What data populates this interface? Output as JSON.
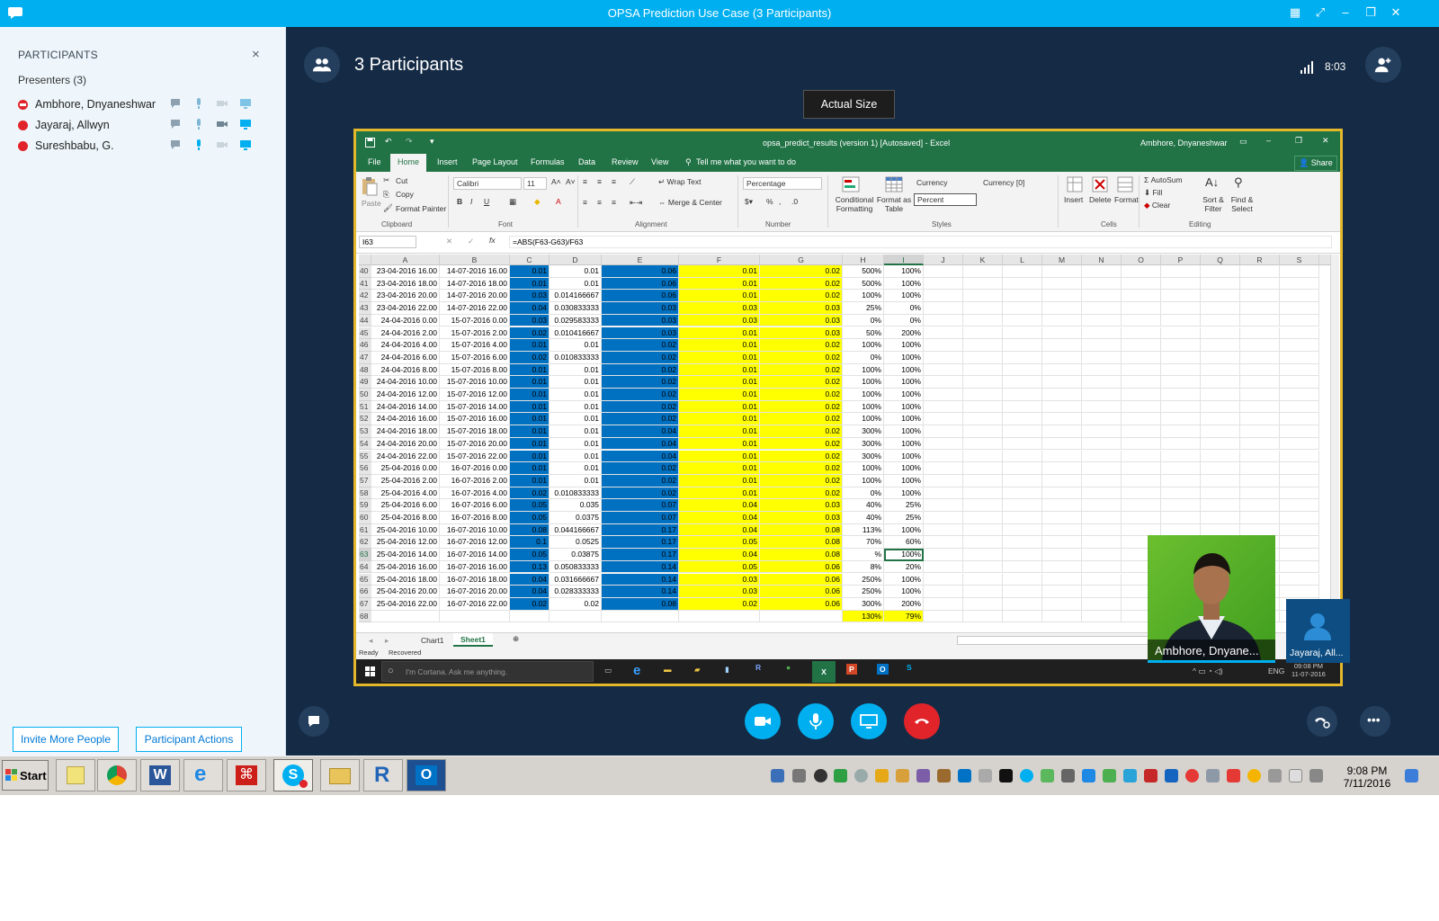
{
  "window": {
    "title": "OPSA Prediction Use Case (3 Participants)"
  },
  "panel": {
    "heading": "PARTICIPANTS",
    "close": "×",
    "section": "Presenters (3)",
    "participants": [
      {
        "name": "Ambhore, Dnyaneshwar"
      },
      {
        "name": "Jayaraj, Allwyn"
      },
      {
        "name": "Sureshbabu, G."
      }
    ],
    "invite_label": "Invite More People",
    "actions_label": "Participant Actions"
  },
  "stage": {
    "title": "3 Participants",
    "time": "8:03",
    "actual_size_label": "Actual Size"
  },
  "excel": {
    "title": "opsa_predict_results (version 1) [Autosaved] - Excel",
    "user": "Ambhore, Dnyaneshwar",
    "share": "Share",
    "tabs": [
      "File",
      "Home",
      "Insert",
      "Page Layout",
      "Formulas",
      "Data",
      "Review",
      "View",
      "Tell me what you want to do"
    ],
    "ribbon": {
      "paste": "Paste",
      "cut": "Cut",
      "copy": "Copy",
      "format_painter": "Format Painter",
      "font": "Calibri",
      "font_size": "11",
      "wrap": "Wrap Text",
      "merge": "Merge & Center",
      "number_format": "Percentage",
      "conditional": "Conditional Formatting",
      "format_table": "Format as Table",
      "style1": "Currency",
      "style2": "Currency [0]",
      "style3": "Percent",
      "insert": "Insert",
      "delete": "Delete",
      "format": "Format",
      "autosum": "AutoSum",
      "fill": "Fill",
      "clear": "Clear",
      "sort": "Sort & Filter",
      "find": "Find & Select"
    },
    "groups": [
      "Clipboard",
      "Font",
      "Alignment",
      "Number",
      "Styles",
      "Cells",
      "Editing"
    ],
    "name_box": "I63",
    "formula": "=ABS(F63-G63)/F63",
    "columns": [
      "A",
      "B",
      "C",
      "D",
      "E",
      "F",
      "G",
      "H",
      "I",
      "J",
      "K",
      "L",
      "M",
      "N",
      "O",
      "P",
      "Q",
      "R",
      "S"
    ],
    "rows": [
      [
        "40",
        "23-04-2016 16.00",
        "14-07-2016 16.00",
        "0.01",
        "0.01",
        "0.06",
        "0.01",
        "0.02",
        "500%",
        "100%"
      ],
      [
        "41",
        "23-04-2016 18.00",
        "14-07-2016 18.00",
        "0.01",
        "0.01",
        "0.06",
        "0.01",
        "0.02",
        "500%",
        "100%"
      ],
      [
        "42",
        "23-04-2016 20.00",
        "14-07-2016 20.00",
        "0.03",
        "0.014166667",
        "0.06",
        "0.01",
        "0.02",
        "100%",
        "100%"
      ],
      [
        "43",
        "23-04-2016 22.00",
        "14-07-2016 22.00",
        "0.04",
        "0.030833333",
        "0.03",
        "0.03",
        "0.03",
        "25%",
        "0%"
      ],
      [
        "44",
        "24-04-2016 0.00",
        "15-07-2016 0.00",
        "0.03",
        "0.029583333",
        "0.03",
        "0.03",
        "0.03",
        "0%",
        "0%"
      ],
      [
        "45",
        "24-04-2016 2.00",
        "15-07-2016 2.00",
        "0.02",
        "0.010416667",
        "0.03",
        "0.01",
        "0.03",
        "50%",
        "200%"
      ],
      [
        "46",
        "24-04-2016 4.00",
        "15-07-2016 4.00",
        "0.01",
        "0.01",
        "0.02",
        "0.01",
        "0.02",
        "100%",
        "100%"
      ],
      [
        "47",
        "24-04-2016 6.00",
        "15-07-2016 6.00",
        "0.02",
        "0.010833333",
        "0.02",
        "0.01",
        "0.02",
        "0%",
        "100%"
      ],
      [
        "48",
        "24-04-2016 8.00",
        "15-07-2016 8.00",
        "0.01",
        "0.01",
        "0.02",
        "0.01",
        "0.02",
        "100%",
        "100%"
      ],
      [
        "49",
        "24-04-2016 10.00",
        "15-07-2016 10.00",
        "0.01",
        "0.01",
        "0.02",
        "0.01",
        "0.02",
        "100%",
        "100%"
      ],
      [
        "50",
        "24-04-2016 12.00",
        "15-07-2016 12.00",
        "0.01",
        "0.01",
        "0.02",
        "0.01",
        "0.02",
        "100%",
        "100%"
      ],
      [
        "51",
        "24-04-2016 14.00",
        "15-07-2016 14.00",
        "0.01",
        "0.01",
        "0.02",
        "0.01",
        "0.02",
        "100%",
        "100%"
      ],
      [
        "52",
        "24-04-2016 16.00",
        "15-07-2016 16.00",
        "0.01",
        "0.01",
        "0.02",
        "0.01",
        "0.02",
        "100%",
        "100%"
      ],
      [
        "53",
        "24-04-2016 18.00",
        "15-07-2016 18.00",
        "0.01",
        "0.01",
        "0.04",
        "0.01",
        "0.02",
        "300%",
        "100%"
      ],
      [
        "54",
        "24-04-2016 20.00",
        "15-07-2016 20.00",
        "0.01",
        "0.01",
        "0.04",
        "0.01",
        "0.02",
        "300%",
        "100%"
      ],
      [
        "55",
        "24-04-2016 22.00",
        "15-07-2016 22.00",
        "0.01",
        "0.01",
        "0.04",
        "0.01",
        "0.02",
        "300%",
        "100%"
      ],
      [
        "56",
        "25-04-2016 0.00",
        "16-07-2016 0.00",
        "0.01",
        "0.01",
        "0.02",
        "0.01",
        "0.02",
        "100%",
        "100%"
      ],
      [
        "57",
        "25-04-2016 2.00",
        "16-07-2016 2.00",
        "0.01",
        "0.01",
        "0.02",
        "0.01",
        "0.02",
        "100%",
        "100%"
      ],
      [
        "58",
        "25-04-2016 4.00",
        "16-07-2016 4.00",
        "0.02",
        "0.010833333",
        "0.02",
        "0.01",
        "0.02",
        "0%",
        "100%"
      ],
      [
        "59",
        "25-04-2016 6.00",
        "16-07-2016 6.00",
        "0.05",
        "0.035",
        "0.07",
        "0.04",
        "0.03",
        "40%",
        "25%"
      ],
      [
        "60",
        "25-04-2016 8.00",
        "16-07-2016 8.00",
        "0.05",
        "0.0375",
        "0.07",
        "0.04",
        "0.03",
        "40%",
        "25%"
      ],
      [
        "61",
        "25-04-2016 10.00",
        "16-07-2016 10.00",
        "0.08",
        "0.044166667",
        "0.17",
        "0.04",
        "0.08",
        "113%",
        "100%"
      ],
      [
        "62",
        "25-04-2016 12.00",
        "16-07-2016 12.00",
        "0.1",
        "0.0525",
        "0.17",
        "0.05",
        "0.08",
        "70%",
        "60%"
      ],
      [
        "63",
        "25-04-2016 14.00",
        "16-07-2016 14.00",
        "0.05",
        "0.03875",
        "0.17",
        "0.04",
        "0.08",
        "%",
        "100%"
      ],
      [
        "64",
        "25-04-2016 16.00",
        "16-07-2016 16.00",
        "0.13",
        "0.050833333",
        "0.14",
        "0.05",
        "0.06",
        "8%",
        "20%"
      ],
      [
        "65",
        "25-04-2016 18.00",
        "16-07-2016 18.00",
        "0.04",
        "0.031666667",
        "0.14",
        "0.03",
        "0.06",
        "250%",
        "100%"
      ],
      [
        "66",
        "25-04-2016 20.00",
        "16-07-2016 20.00",
        "0.04",
        "0.028333333",
        "0.14",
        "0.03",
        "0.06",
        "250%",
        "100%"
      ],
      [
        "67",
        "25-04-2016 22.00",
        "16-07-2016 22.00",
        "0.02",
        "0.02",
        "0.08",
        "0.02",
        "0.06",
        "300%",
        "200%"
      ],
      [
        "68",
        "",
        "",
        "",
        "",
        "",
        "",
        "",
        "130%",
        "79%"
      ]
    ],
    "sheets": [
      "Chart1",
      "Sheet1"
    ],
    "status": [
      "Ready",
      "Recovered"
    ],
    "cortana": "I'm Cortana. Ask me anything.",
    "tray": {
      "lang": "ENG",
      "time": "09:08 PM",
      "date": "11-07-2016"
    }
  },
  "video": {
    "main_name": "Ambhore, Dnyane...",
    "small_name": "Jayaraj, All..."
  },
  "taskbar": {
    "start": "Start",
    "time": "9:08 PM",
    "date": "7/11/2016"
  },
  "colors": {
    "skype": "#00aff0",
    "excel": "#217346",
    "blue_col": "#0070c0",
    "yellow_col": "#ffff00",
    "hangup": "#e0242a"
  }
}
